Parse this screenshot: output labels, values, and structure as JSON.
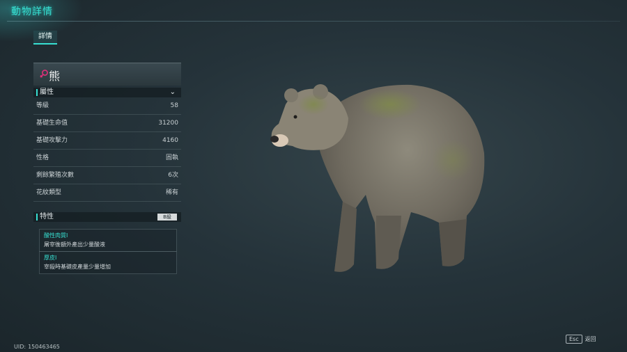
{
  "header": {
    "title": "動物詳情"
  },
  "tabs": [
    {
      "label": "詳情"
    }
  ],
  "animal": {
    "name": "熊",
    "gender_icon": "female-icon"
  },
  "attributes": {
    "section_label": "屬性",
    "rows": [
      {
        "label": "等級",
        "value": "58"
      },
      {
        "label": "基礎生命值",
        "value": "31200"
      },
      {
        "label": "基礎攻擊力",
        "value": "4160"
      },
      {
        "label": "性格",
        "value": "固執"
      },
      {
        "label": "剩餘繁殖次數",
        "value": "6次"
      },
      {
        "label": "花紋類型",
        "value": "稀有"
      }
    ]
  },
  "traits": {
    "section_label": "特性",
    "grade": "B級",
    "items": [
      {
        "name": "酸性肉質I",
        "desc": "屠宰後額外產出少量酸液"
      },
      {
        "name": "厚皮I",
        "desc": "宰殺時基礎皮產量少量增加"
      }
    ]
  },
  "footer": {
    "esc_key": "Esc",
    "esc_label": "返回",
    "uid_label": "UID:",
    "uid_value": "150463465"
  },
  "colors": {
    "accent": "#37e0d2",
    "bg": "#25333a"
  }
}
